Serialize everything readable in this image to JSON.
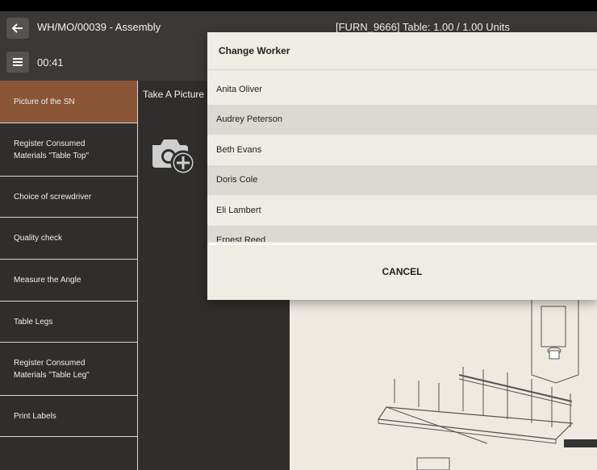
{
  "header": {
    "mo_title": "WH/MO/00039 - Assembly",
    "timer": "00:41",
    "product_info": "[FURN_9666] Table: 1.00 / 1.00 Units"
  },
  "steps": [
    {
      "label": "Picture of the SN"
    },
    {
      "label": "Register Consumed\nMaterials \"Table Top\""
    },
    {
      "label": "Choice of screwdriver"
    },
    {
      "label": "Quality check"
    },
    {
      "label": "Measure the Angle"
    },
    {
      "label": "Table Legs"
    },
    {
      "label": "Register Consumed\nMaterials \"Table Leg\""
    },
    {
      "label": "Print Labels"
    }
  ],
  "work": {
    "take_picture": "Take A Picture"
  },
  "modal": {
    "title": "Change Worker",
    "workers": [
      "Anita Oliver",
      "Audrey Peterson",
      "Beth Evans",
      "Doris Cole",
      "Eli Lambert",
      "Ernest Reed"
    ],
    "cancel_label": "CANCEL"
  },
  "colors": {
    "active_step": "#8a5537",
    "background": "#2f2e2c",
    "modal_bg": "#efece4"
  }
}
